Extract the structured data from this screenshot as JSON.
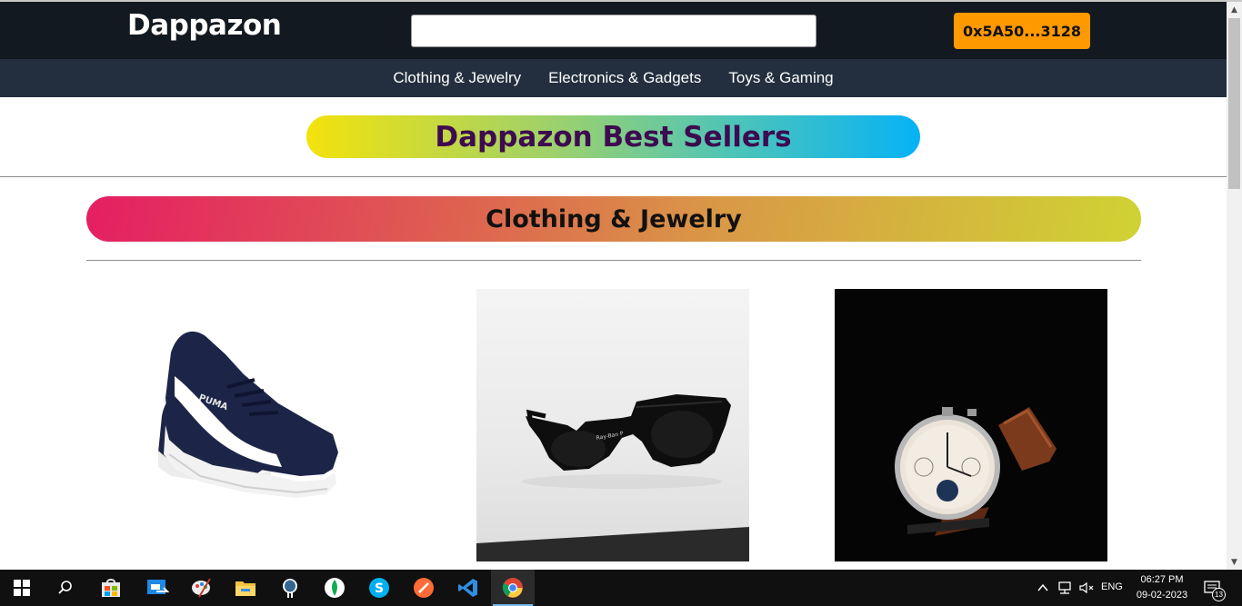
{
  "header": {
    "logo": "Dappazon",
    "search_value": "",
    "account_label": "0x5A50...3128"
  },
  "nav": {
    "items": [
      {
        "label": "Clothing & Jewelry"
      },
      {
        "label": "Electronics & Gadgets"
      },
      {
        "label": "Toys & Gaming"
      }
    ]
  },
  "main": {
    "hero_title": "Dappazon Best Sellers",
    "section_title": "Clothing & Jewelry",
    "products": [
      {
        "icon": "sneakers-image"
      },
      {
        "icon": "sunglasses-image"
      },
      {
        "icon": "wristwatch-image"
      }
    ]
  },
  "taskbar": {
    "apps": [
      "start-icon",
      "search-icon",
      "store-icon",
      "mail-icon",
      "paint-icon",
      "file-explorer-icon",
      "postgres-icon",
      "mongodb-icon",
      "skype-icon",
      "postman-icon",
      "vscode-icon",
      "chrome-icon"
    ],
    "language": "ENG",
    "time": "06:27 PM",
    "date": "09-02-2023",
    "notification_count": "13"
  },
  "colors": {
    "header_bg": "#131921",
    "nav_bg": "#232f3e",
    "account_button": "#ff9900",
    "hero_text": "#3d0b4f"
  }
}
